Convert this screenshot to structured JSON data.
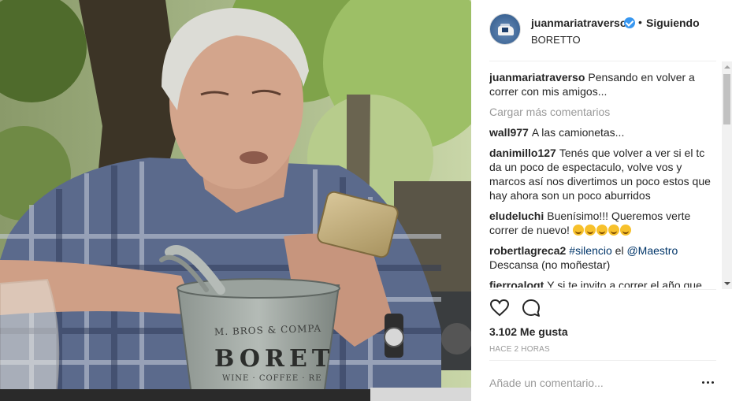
{
  "post": {
    "username": "juanmariatraverso",
    "separator": "•",
    "follow_status": "Siguiendo",
    "location": "BORETTO",
    "caption": "Pensando en volver a correr con mis amigos..."
  },
  "comments": {
    "load_more": "Cargar más comentarios",
    "items": [
      {
        "user": "wall977",
        "text": "A las camionetas..."
      },
      {
        "user": "danimillo127",
        "text": "Tenés que volver a ver si el tc da un poco de espectaculo, volve vos y marcos así nos divertimos un poco estos que hay ahora son un poco aburridos"
      },
      {
        "user": "eludeluchi",
        "text": "Buenísimo!!! Queremos verte correr de nuevo!"
      },
      {
        "user": "robertlagreca2",
        "tag": "#silencio",
        "middle": "el",
        "mention": "@Maestro",
        "text": "Descansa (no moñestar)"
      },
      {
        "user": "fierroalogt",
        "text": "Y si te invito a correr el año que"
      }
    ]
  },
  "stats": {
    "likes": "3.102 Me gusta",
    "time": "HACE 2 HORAS"
  },
  "compose": {
    "placeholder": "Añade un comentario..."
  },
  "photo": {
    "bucket_line1": "M. BROS & COMPA",
    "bucket_brand": "BORET",
    "bucket_line2": "WINE · COFFEE · RE"
  },
  "icons": {
    "like": "heart-icon",
    "comment": "comment-bubble-icon",
    "verified": "verified-badge-icon",
    "more": "more-options-icon"
  },
  "colors": {
    "link": "#003569",
    "verified": "#3897f0",
    "muted": "#999999"
  }
}
